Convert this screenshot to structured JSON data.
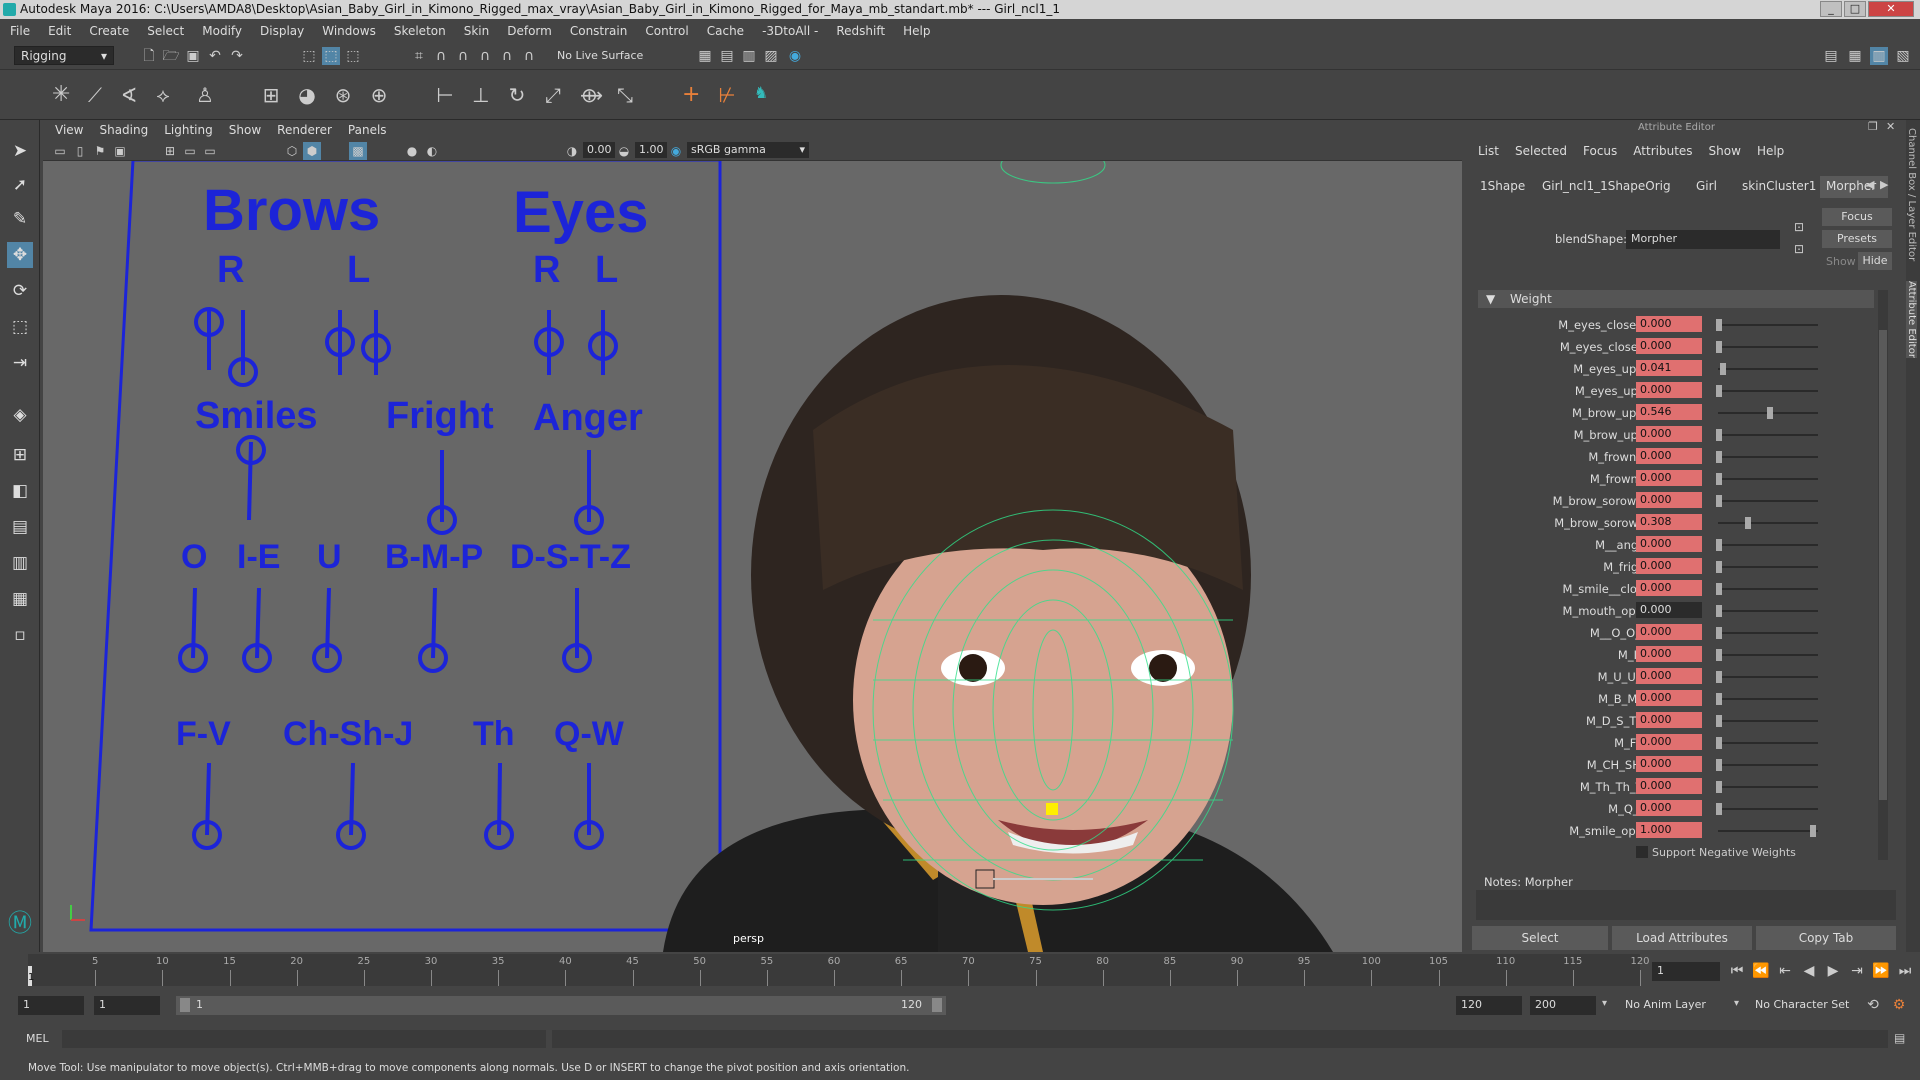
{
  "window": {
    "title": "Autodesk Maya 2016: C:\\Users\\AMDA8\\Desktop\\Asian_Baby_Girl_in_Kimono_Rigged_max_vray\\Asian_Baby_Girl_in_Kimono_Rigged_for_Maya_mb_standart.mb*   ---   Girl_ncl1_1"
  },
  "menubar": [
    "File",
    "Edit",
    "Create",
    "Select",
    "Modify",
    "Display",
    "Windows",
    "Skeleton",
    "Skin",
    "Deform",
    "Constrain",
    "Control",
    "Cache",
    "-3DtoAll -",
    "Redshift",
    "Help"
  ],
  "shelf": {
    "mode": "Rigging",
    "live_surface": "No Live Surface"
  },
  "viewport": {
    "menu": [
      "View",
      "Shading",
      "Lighting",
      "Show",
      "Renderer",
      "Panels"
    ],
    "exposure": "0.00",
    "gamma": "1.00",
    "color_space": "sRGB gamma",
    "camera": "persp",
    "controls": {
      "brows": "Brows",
      "eyes": "Eyes",
      "r": "R",
      "l": "L",
      "smiles": "Smiles",
      "fright": "Fright",
      "anger": "Anger",
      "o": "O",
      "ie": "I-E",
      "u": "U",
      "bmp": "B-M-P",
      "dstz": "D-S-T-Z",
      "fv": "F-V",
      "chshj": "Ch-Sh-J",
      "th": "Th",
      "qw": "Q-W"
    }
  },
  "attr_editor": {
    "title": "Attribute Editor",
    "menu": [
      "List",
      "Selected",
      "Focus",
      "Attributes",
      "Show",
      "Help"
    ],
    "tabs": [
      "1Shape",
      "Girl_ncl1_1ShapeOrig",
      "Girl",
      "skinCluster1",
      "Morpher"
    ],
    "active_tab": "Morpher",
    "focus_btn": "Focus",
    "presets_btn": "Presets",
    "show_label": "Show",
    "hide_btn": "Hide",
    "blendshape_label": "blendShape:",
    "blendshape_value": "Morpher",
    "section": "Weight",
    "weights": [
      {
        "name": "M_eyes_close_R",
        "value": "0.000",
        "level": 0.0
      },
      {
        "name": "M_eyes_close_L",
        "value": "0.000",
        "level": 0.0
      },
      {
        "name": "M_eyes_up_R",
        "value": "0.041",
        "level": 0.041
      },
      {
        "name": "M_eyes_up_L",
        "value": "0.000",
        "level": 0.0
      },
      {
        "name": "M_brow_up_R",
        "value": "0.546",
        "level": 0.546
      },
      {
        "name": "M_brow_up_L",
        "value": "0.000",
        "level": 0.0
      },
      {
        "name": "M_frown_R",
        "value": "0.000",
        "level": 0.0
      },
      {
        "name": "M_frown_L",
        "value": "0.000",
        "level": 0.0
      },
      {
        "name": "M_brow_sorow_R",
        "value": "0.000",
        "level": 0.0
      },
      {
        "name": "M_brow_sorow_L",
        "value": "0.308",
        "level": 0.308
      },
      {
        "name": "M__anger",
        "value": "0.000",
        "level": 0.0
      },
      {
        "name": "M_fright",
        "value": "0.000",
        "level": 0.0
      },
      {
        "name": "M_smile__close",
        "value": "0.000",
        "level": 0.0
      },
      {
        "name": "M_mouth_open",
        "value": "0.000",
        "level": 0.0,
        "plain": true
      },
      {
        "name": "M__O_O_O",
        "value": "0.000",
        "level": 0.0
      },
      {
        "name": "M_I_E",
        "value": "0.000",
        "level": 0.0
      },
      {
        "name": "M_U_U_U",
        "value": "0.000",
        "level": 0.0
      },
      {
        "name": "M_B_M_P",
        "value": "0.000",
        "level": 0.0
      },
      {
        "name": "M_D_S_T_Z",
        "value": "0.000",
        "level": 0.0
      },
      {
        "name": "M_F_V",
        "value": "0.000",
        "level": 0.0
      },
      {
        "name": "M_CH_SH_J",
        "value": "0.000",
        "level": 0.0
      },
      {
        "name": "M_Th_Th_Th",
        "value": "0.000",
        "level": 0.0
      },
      {
        "name": "M_Q_W",
        "value": "0.000",
        "level": 0.0
      },
      {
        "name": "M_smile_open",
        "value": "1.000",
        "level": 1.0
      }
    ],
    "negative_weights": "Support Negative Weights",
    "notes_label": "Notes:  Morpher",
    "buttons": [
      "Select",
      "Load Attributes",
      "Copy Tab"
    ],
    "side_tabs": [
      "Channel Box / Layer Editor",
      "Attribute Editor"
    ]
  },
  "timeline": {
    "ticks": [
      "5",
      "10",
      "15",
      "20",
      "25",
      "30",
      "35",
      "40",
      "45",
      "50",
      "55",
      "60",
      "65",
      "70",
      "75",
      "80",
      "85",
      "90",
      "95",
      "100",
      "105",
      "110",
      "115",
      "120"
    ],
    "current_frame": "1",
    "frame_field": "1"
  },
  "range": {
    "start": "1",
    "playback_start": "1",
    "slider_start": "1",
    "slider_end": "120",
    "playback_end": "120",
    "end": "200",
    "anim_layer": "No Anim Layer",
    "char_set": "No Character Set"
  },
  "cmdline": {
    "label": "MEL"
  },
  "helpline": {
    "text": "Move Tool: Use manipulator to move object(s). Ctrl+MMB+drag to move components along normals. Use D or INSERT to change the pivot position and axis orientation."
  }
}
